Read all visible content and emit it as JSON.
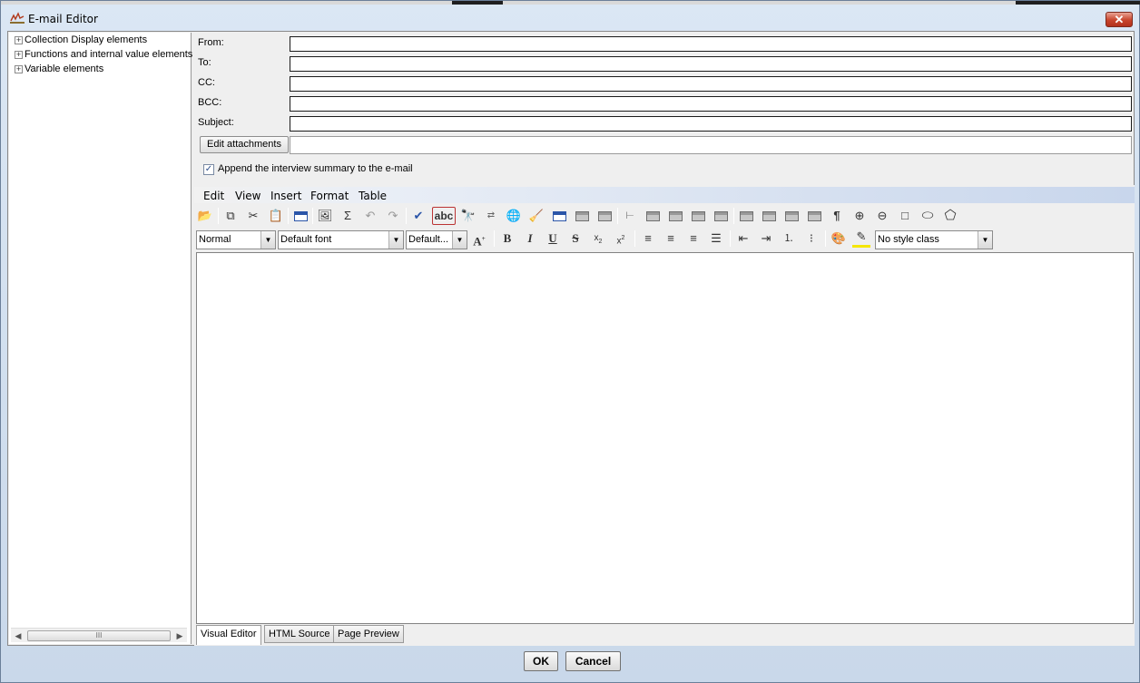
{
  "window": {
    "title": "E-mail Editor",
    "close_symbol": "✕"
  },
  "tree": {
    "items": [
      {
        "label": "Collection Display elements"
      },
      {
        "label": "Functions and internal value elements"
      },
      {
        "label": "Variable elements"
      }
    ],
    "scroll_grip": "III"
  },
  "form": {
    "from_label": "From:",
    "to_label": "To:",
    "cc_label": "CC:",
    "bcc_label": "BCC:",
    "subject_label": "Subject:",
    "from_value": "",
    "to_value": "",
    "cc_value": "",
    "bcc_value": "",
    "subject_value": "",
    "edit_attachments_label": "Edit attachments",
    "attachments_value": "",
    "append_summary_label": "Append the interview summary to the e-mail",
    "append_summary_checked": true
  },
  "editor": {
    "menu": [
      "Edit",
      "View",
      "Insert",
      "Format",
      "Table"
    ],
    "paragraph_style": "Normal",
    "font": "Default font",
    "font_size": "Default...",
    "style_class": "No style class",
    "bottom_tabs": [
      "Visual Editor",
      "HTML Source",
      "Page Preview"
    ],
    "active_tab": "Visual Editor",
    "content": ""
  },
  "footer": {
    "ok_label": "OK",
    "cancel_label": "Cancel"
  },
  "colors": {
    "title_bar": "#dbe7f4",
    "close_button": "#c8442c",
    "menu_gradient_end": "#c8d6ec"
  }
}
